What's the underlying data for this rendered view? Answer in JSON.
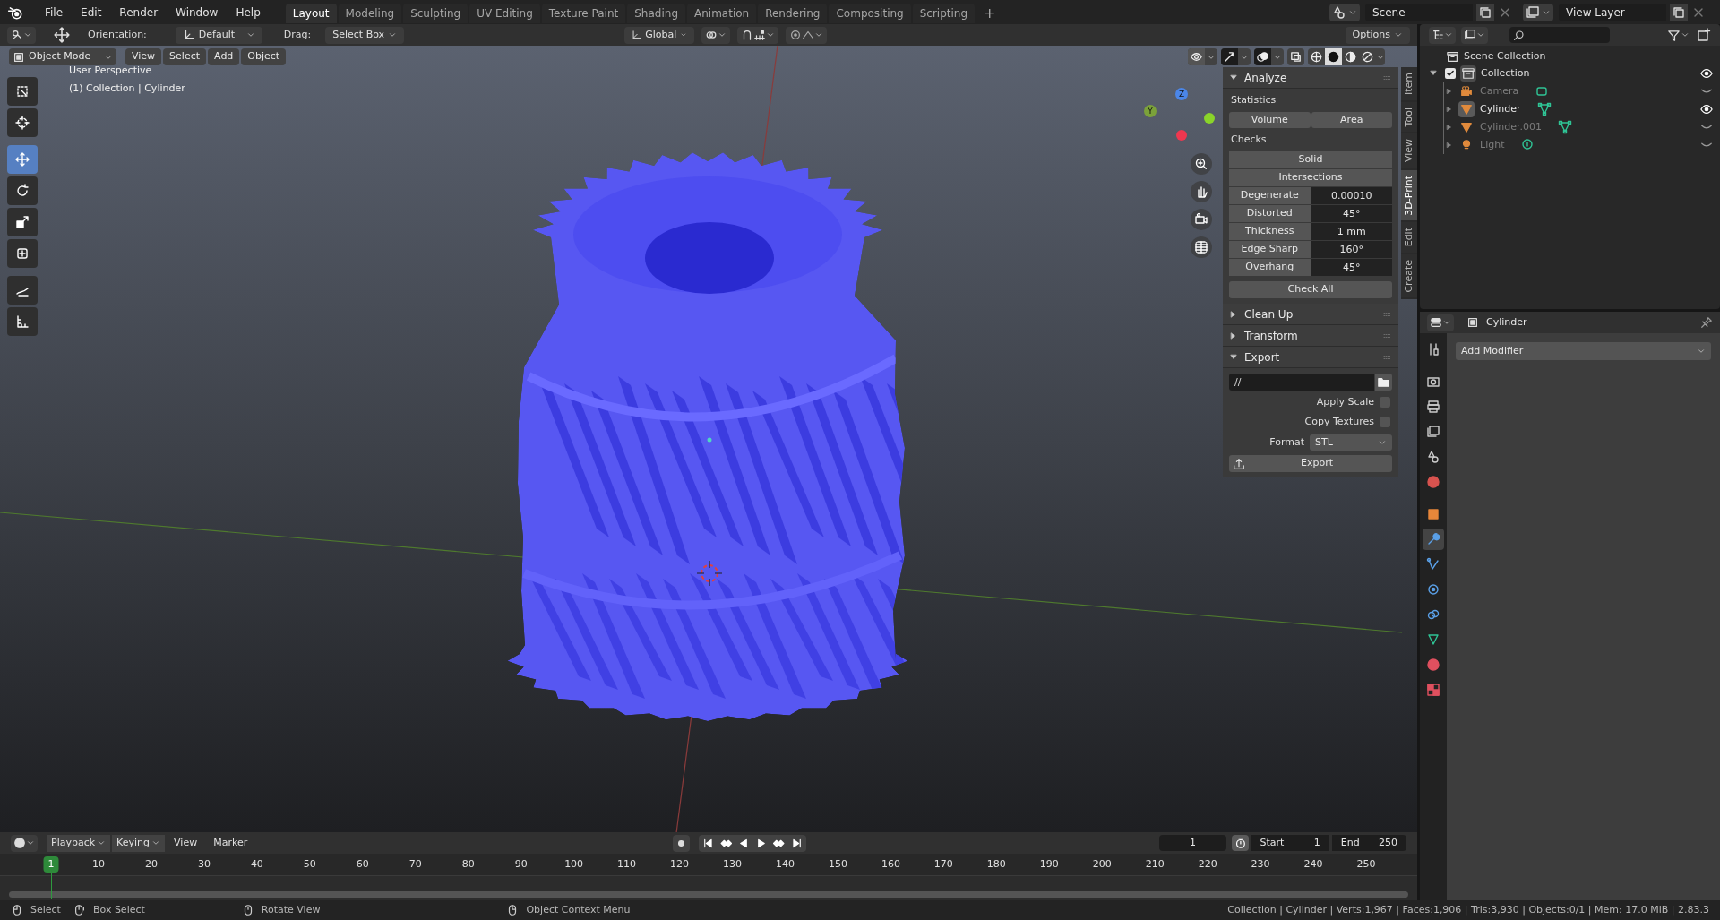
{
  "menu": [
    "File",
    "Edit",
    "Render",
    "Window",
    "Help"
  ],
  "workspaces": [
    {
      "label": "Layout",
      "selected": true
    },
    {
      "label": "Modeling",
      "selected": false
    },
    {
      "label": "Sculpting",
      "selected": false
    },
    {
      "label": "UV Editing",
      "selected": false
    },
    {
      "label": "Texture Paint",
      "selected": false
    },
    {
      "label": "Shading",
      "selected": false
    },
    {
      "label": "Animation",
      "selected": false
    },
    {
      "label": "Rendering",
      "selected": false
    },
    {
      "label": "Compositing",
      "selected": false
    },
    {
      "label": "Scripting",
      "selected": false
    }
  ],
  "add_workspace": "+",
  "scene": "Scene",
  "view_layer": "View Layer",
  "tool_header": {
    "orientation_label": "Orientation:",
    "orientation": "Default",
    "drag_label": "Drag:",
    "drag": "Select Box",
    "transform": "Global",
    "options": "Options"
  },
  "viewport": {
    "mode": "Object Mode",
    "menus": [
      "View",
      "Select",
      "Add",
      "Object"
    ],
    "info": [
      "User Perspective",
      "(1) Collection | Cylinder"
    ],
    "gizmo": [
      {
        "label": "Z",
        "color": "#4b86e8"
      },
      {
        "label": "Y",
        "color": "#7ba23a"
      }
    ],
    "toggles": [
      {
        "kind": "visibility",
        "on": false
      },
      {
        "kind": "gizmos",
        "on": true
      },
      {
        "kind": "overlays",
        "on": true
      }
    ],
    "shading": [
      {
        "kind": "wireframe",
        "selected": false
      },
      {
        "kind": "solid",
        "selected": true
      },
      {
        "kind": "material",
        "selected": false
      },
      {
        "kind": "rendered",
        "selected": false
      }
    ]
  },
  "toolbar": [
    {
      "kind": "select",
      "selected": false
    },
    {
      "kind": "cursor",
      "selected": false
    },
    {
      "kind": "move",
      "selected": true
    },
    {
      "kind": "rotate",
      "selected": false
    },
    {
      "kind": "scale",
      "selected": false
    },
    {
      "kind": "transform",
      "selected": false
    },
    {
      "kind": "annotate",
      "selected": false
    },
    {
      "kind": "measure",
      "selected": false
    }
  ],
  "n_panel": {
    "tabs": [
      {
        "label": "Item",
        "selected": false
      },
      {
        "label": "Tool",
        "selected": false
      },
      {
        "label": "View",
        "selected": false
      },
      {
        "label": "3D-Print",
        "selected": true
      },
      {
        "label": "Edit",
        "selected": false
      },
      {
        "label": "Create",
        "selected": false
      }
    ],
    "analyze": {
      "title": "Analyze",
      "expanded": true,
      "statistics_label": "Statistics",
      "statistics": [
        "Volume",
        "Area"
      ],
      "checks_label": "Checks",
      "checks": [
        "Solid",
        "Intersections"
      ],
      "params": [
        {
          "label": "Degenerate",
          "value": "0.00010"
        },
        {
          "label": "Distorted",
          "value": "45°"
        },
        {
          "label": "Thickness",
          "value": "1 mm"
        },
        {
          "label": "Edge Sharp",
          "value": "160°"
        },
        {
          "label": "Overhang",
          "value": "45°"
        }
      ],
      "check_all": "Check All"
    },
    "collapsed": [
      {
        "title": "Clean Up",
        "expanded": false
      },
      {
        "title": "Transform",
        "expanded": false
      }
    ],
    "export": {
      "title": "Export",
      "expanded": true,
      "path": "//",
      "options": [
        {
          "label": "Apply Scale",
          "checked": false
        },
        {
          "label": "Copy Textures",
          "checked": false
        }
      ],
      "format_label": "Format",
      "format": "STL",
      "button": "Export"
    }
  },
  "outliner": {
    "root": "Scene Collection",
    "collections": [
      {
        "name": "Collection",
        "expanded": true,
        "checked": true,
        "visible": true,
        "children": [
          {
            "name": "Camera",
            "kind": "camera",
            "visible": false,
            "selected": false
          },
          {
            "name": "Cylinder",
            "kind": "mesh",
            "visible": true,
            "selected": true
          },
          {
            "name": "Cylinder.001",
            "kind": "mesh",
            "visible": false,
            "selected": false
          },
          {
            "name": "Light",
            "kind": "light",
            "visible": false,
            "selected": false
          }
        ]
      }
    ]
  },
  "properties": {
    "object": "Cylinder",
    "add_modifier": "Add Modifier",
    "tabs": [
      {
        "kind": "tool",
        "selected": false
      },
      {
        "kind": "render",
        "selected": false
      },
      {
        "kind": "output",
        "selected": false
      },
      {
        "kind": "view_layer",
        "selected": false
      },
      {
        "kind": "scene",
        "selected": false
      },
      {
        "kind": "world",
        "selected": false
      },
      {
        "kind": "object",
        "selected": false
      },
      {
        "kind": "modifiers",
        "selected": true
      },
      {
        "kind": "particles",
        "selected": false
      },
      {
        "kind": "physics",
        "selected": false
      },
      {
        "kind": "constraints",
        "selected": false
      },
      {
        "kind": "data",
        "selected": false
      },
      {
        "kind": "material",
        "selected": false
      },
      {
        "kind": "texture",
        "selected": false
      }
    ]
  },
  "timeline": {
    "menus": [
      "Playback",
      "Keying"
    ],
    "plain_menus": [
      "View",
      "Marker"
    ],
    "current_frame": "1",
    "start_label": "Start",
    "start": "1",
    "end_label": "End",
    "end": "250",
    "ruler": [
      {
        "label": "1",
        "current": true
      },
      {
        "label": "10",
        "current": false
      },
      {
        "label": "20",
        "current": false
      },
      {
        "label": "30",
        "current": false
      },
      {
        "label": "40",
        "current": false
      },
      {
        "label": "50",
        "current": false
      },
      {
        "label": "60",
        "current": false
      },
      {
        "label": "70",
        "current": false
      },
      {
        "label": "80",
        "current": false
      },
      {
        "label": "90",
        "current": false
      },
      {
        "label": "100",
        "current": false
      },
      {
        "label": "110",
        "current": false
      },
      {
        "label": "120",
        "current": false
      },
      {
        "label": "130",
        "current": false
      },
      {
        "label": "140",
        "current": false
      },
      {
        "label": "150",
        "current": false
      },
      {
        "label": "160",
        "current": false
      },
      {
        "label": "170",
        "current": false
      },
      {
        "label": "180",
        "current": false
      },
      {
        "label": "190",
        "current": false
      },
      {
        "label": "200",
        "current": false
      },
      {
        "label": "210",
        "current": false
      },
      {
        "label": "220",
        "current": false
      },
      {
        "label": "230",
        "current": false
      },
      {
        "label": "240",
        "current": false
      },
      {
        "label": "250",
        "current": false
      }
    ]
  },
  "status_bar": {
    "hints": [
      {
        "kind": "left",
        "label": "Select"
      },
      {
        "kind": "drag",
        "label": "Box Select"
      },
      {
        "kind": "middle",
        "label": "Rotate View"
      },
      {
        "kind": "right",
        "label": "Object Context Menu"
      }
    ],
    "stats": "Collection | Cylinder | Verts:1,967 | Faces:1,906 | Tris:3,930 | Objects:0/1 | Mem: 17.0 MiB | 2.83.3"
  }
}
